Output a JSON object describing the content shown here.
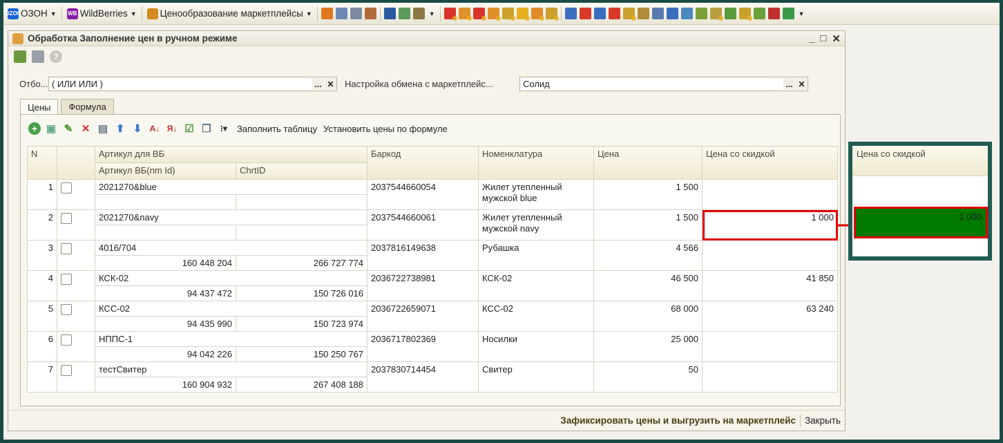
{
  "topbar": {
    "menus": [
      {
        "label": "ОЗОН",
        "logo": "OZON",
        "color": "#1a63d8"
      },
      {
        "label": "WildBerries",
        "logo": "WB",
        "color": "#8a1ca6"
      },
      {
        "label": "Ценообразование маркетплейсы",
        "logo": "",
        "color": "#d18b1e"
      }
    ]
  },
  "window": {
    "title": "Обработка  Заполнение цен в ручном режиме",
    "controls": [
      "_",
      "□",
      "✕"
    ]
  },
  "filters": {
    "otbor_label": "Отбо...",
    "otbor_value": "( ИЛИ ИЛИ )",
    "exchange_label": "Настройка обмена с маркетплейс...",
    "exchange_value": "Солид"
  },
  "tabs": [
    {
      "label": "Цены",
      "active": true
    },
    {
      "label": "Формула",
      "active": false
    }
  ],
  "actions": {
    "fill_table": "Заполнить таблицу",
    "set_prices": "Установить цены по формуле"
  },
  "table": {
    "headers": {
      "n": "N",
      "article_group": "Артикул для ВБ",
      "article_nm": "Артикул ВБ(nm Id)",
      "chrt": "ChrtID",
      "barcode": "Баркод",
      "nomenclature": "Номенклатура",
      "price": "Цена",
      "discount_price": "Цена со скидкой"
    },
    "rows": [
      {
        "n": "1",
        "article": "2021270&blue",
        "nm_id": "",
        "chrt_id": "",
        "barcode": "2037544660054",
        "nomenclature": "Жилет утепленный мужской blue",
        "price": "1 500",
        "discount_price": ""
      },
      {
        "n": "2",
        "article": "2021270&navy",
        "nm_id": "",
        "chrt_id": "",
        "barcode": "2037544660061",
        "nomenclature": "Жилет утепленный мужской navy",
        "price": "1 500",
        "discount_price": "1 000"
      },
      {
        "n": "3",
        "article": "4016/704",
        "nm_id": "160 448 204",
        "chrt_id": "266 727 774",
        "barcode": "2037816149638",
        "nomenclature": "Рубашка",
        "price": "4 566",
        "discount_price": ""
      },
      {
        "n": "4",
        "article": "КСК-02",
        "nm_id": "94 437 472",
        "chrt_id": "150 726 016",
        "barcode": "2036722738981",
        "nomenclature": "КСК-02",
        "price": "46 500",
        "discount_price": "41 850"
      },
      {
        "n": "5",
        "article": "КСС-02",
        "nm_id": "94 435 990",
        "chrt_id": "150 723 974",
        "barcode": "2036722659071",
        "nomenclature": "КСС-02",
        "price": "68 000",
        "discount_price": "63 240"
      },
      {
        "n": "6",
        "article": "НППС-1",
        "nm_id": "94 042 226",
        "chrt_id": "150 250 767",
        "barcode": "2036717802369",
        "nomenclature": "Носилки",
        "price": "25 000",
        "discount_price": ""
      },
      {
        "n": "7",
        "article": "тестСвитер",
        "nm_id": "160 904 932",
        "chrt_id": "267 408 188",
        "barcode": "2037830714454",
        "nomenclature": "Свитер",
        "price": "50",
        "discount_price": ""
      }
    ]
  },
  "footer": {
    "primary": "Зафиксировать цены и выгрузить на маркетплейс",
    "close": "Закрыть"
  },
  "inset": {
    "header": "Цена со скидкой",
    "value": "1 000",
    "highlight_color": "#007a00"
  }
}
